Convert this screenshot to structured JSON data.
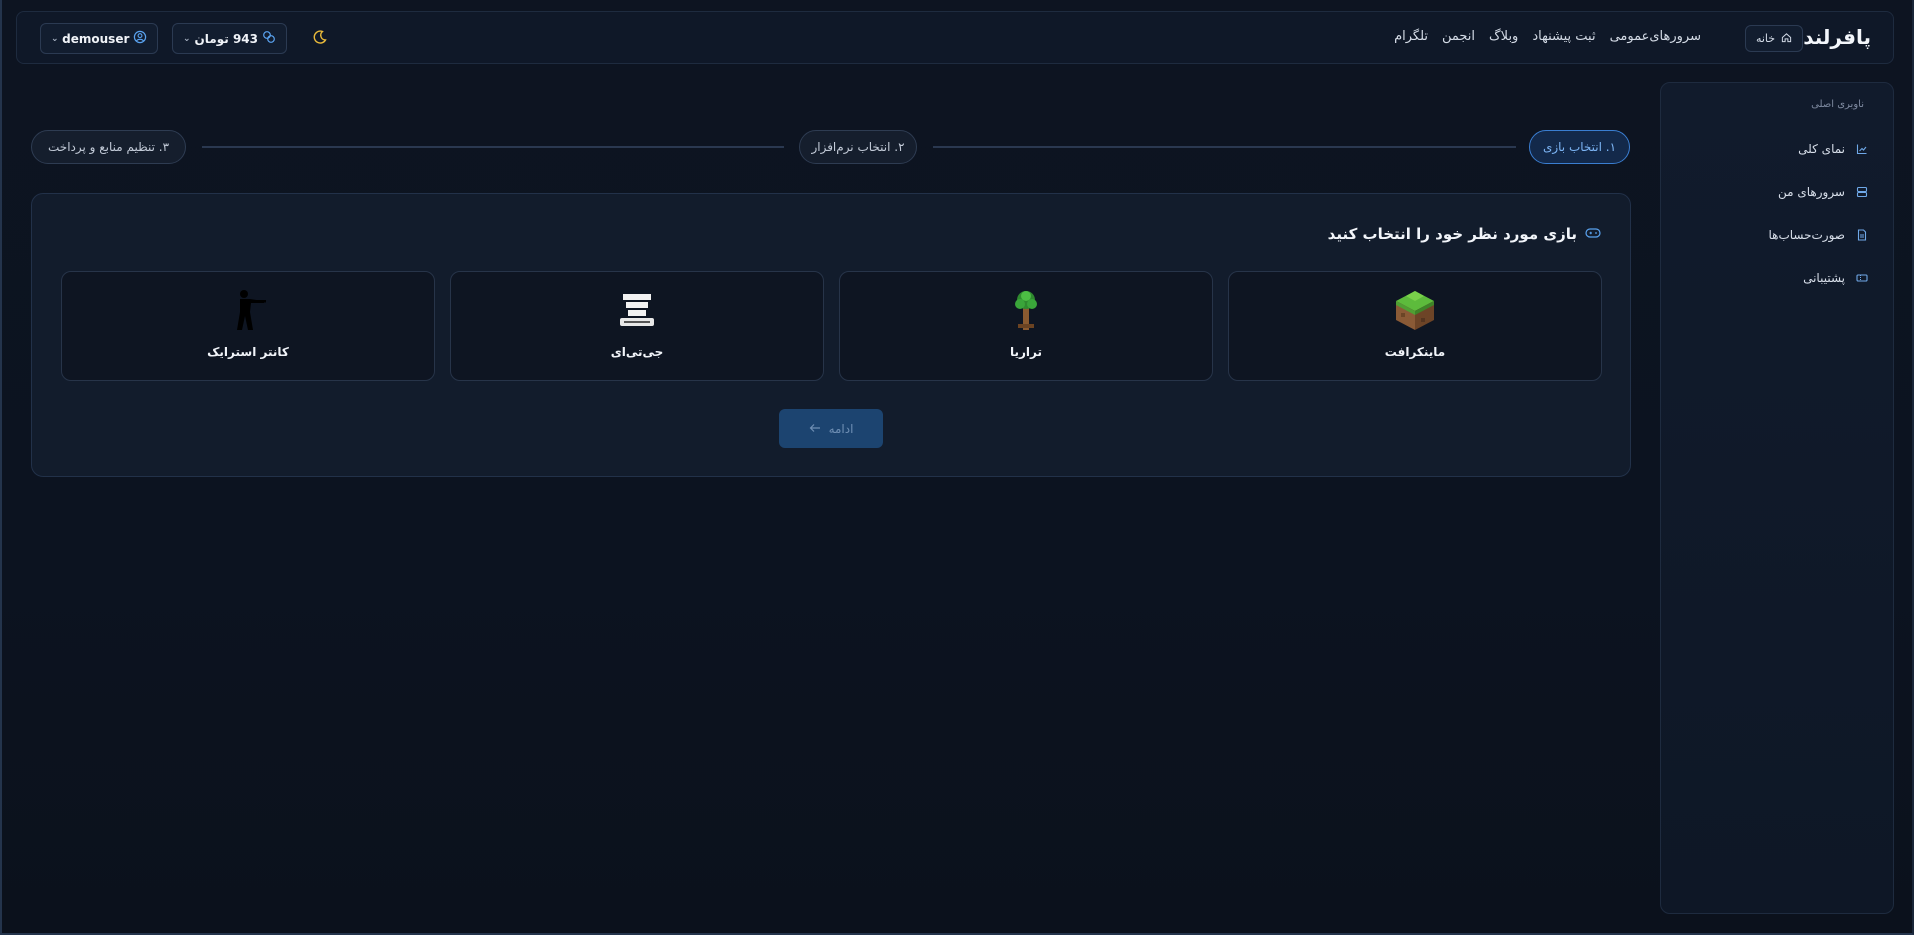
{
  "header": {
    "brand": "پافرلند",
    "home_label": "خانه",
    "nav": [
      "سرورهای‌عمومی",
      "ثبت پیشنهاد",
      "وبلاگ",
      "انجمن",
      "تلگرام"
    ],
    "username": "demouser",
    "balance": "943 تومان"
  },
  "sidebar": {
    "title": "ناوبری اصلی",
    "items": [
      {
        "label": "نمای کلی",
        "icon": "chart-icon"
      },
      {
        "label": "سرورهای من",
        "icon": "server-icon"
      },
      {
        "label": "صورت‌حساب‌ها",
        "icon": "invoice-icon"
      },
      {
        "label": "پشتیبانی",
        "icon": "ticket-icon"
      }
    ]
  },
  "steps": [
    "۱. انتخاب بازی",
    "۲. انتخاب نرم‌افزار",
    "۳. تنظیم منابع و پرداخت"
  ],
  "main": {
    "title": "بازی مورد نظر خود را انتخاب کنید",
    "games": [
      {
        "name": "ماینکرافت",
        "icon": "minecraft-grass-block-icon"
      },
      {
        "name": "تراریا",
        "icon": "terraria-tree-icon"
      },
      {
        "name": "جی‌تی‌ای",
        "icon": "gta-san-andreas-logo"
      },
      {
        "name": "کانتر استرایک",
        "icon": "counter-strike-soldier-icon"
      }
    ],
    "continue_label": "ادامه"
  },
  "colors": {
    "accent": "#3a7ed1",
    "background": "#0d1421",
    "card": "#121c2c",
    "button_disabled": "#1c4470"
  }
}
